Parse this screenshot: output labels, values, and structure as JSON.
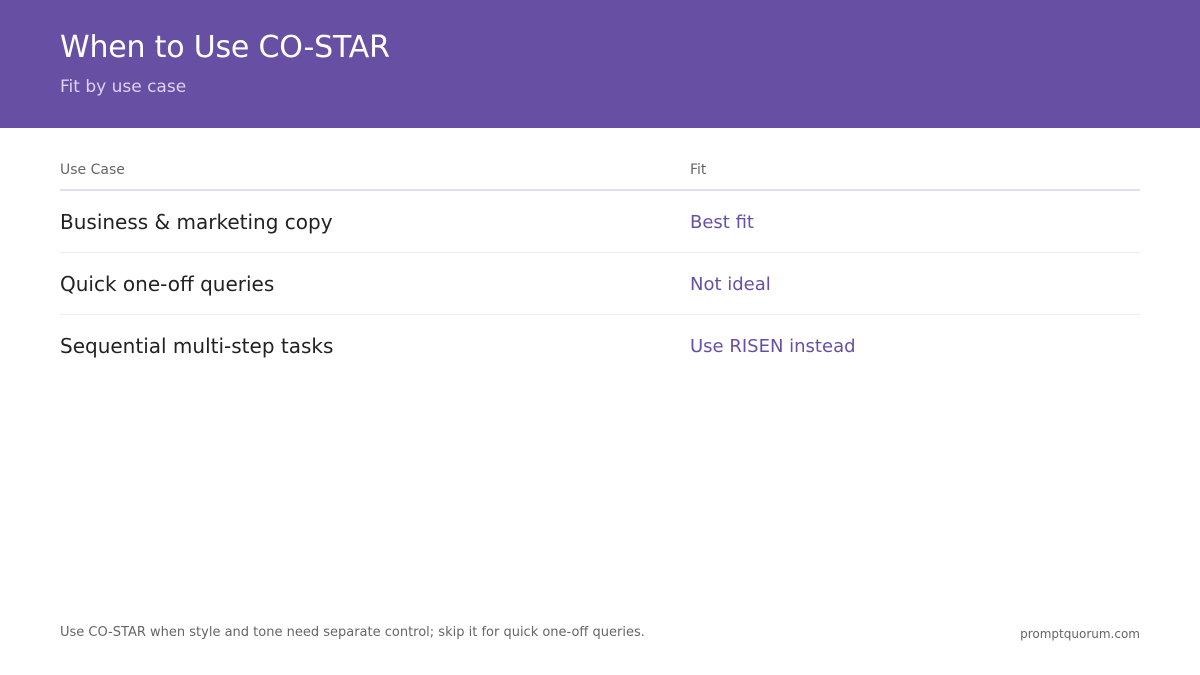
{
  "header": {
    "title": "When to Use CO-STAR",
    "subtitle": "Fit by use case"
  },
  "table": {
    "columns": [
      "Use Case",
      "Fit"
    ],
    "rows": [
      {
        "use_case": "Business & marketing copy",
        "fit": "Best fit"
      },
      {
        "use_case": "Quick one-off queries",
        "fit": "Not ideal"
      },
      {
        "use_case": "Sequential multi-step tasks",
        "fit": "Use RISEN instead"
      }
    ]
  },
  "footer": {
    "note": "Use CO-STAR when style and tone need separate control; skip it for quick one-off queries.",
    "site": "promptquorum.com"
  },
  "colors": {
    "accent": "#6750a4",
    "header_bg": "#6750a4"
  }
}
